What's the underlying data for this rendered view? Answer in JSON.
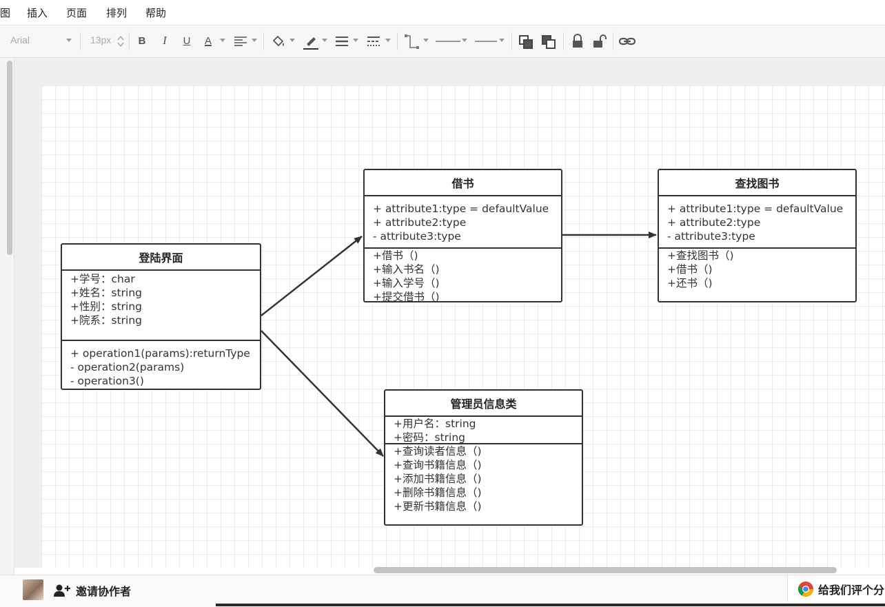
{
  "menu": {
    "items": [
      "图",
      "插入",
      "页面",
      "排列",
      "帮助"
    ]
  },
  "toolbar": {
    "font_family": "Arial",
    "font_size": "13px",
    "bold_label": "B",
    "italic_label": "I",
    "underline_label": "U",
    "font_color_label": "A"
  },
  "diagram": {
    "classes": [
      {
        "title": "登陆界面",
        "attributes": [
          "+学号：char",
          "+姓名：string",
          "+性别：string",
          "+院系：string"
        ],
        "operations": [
          "+ operation1(params):returnType",
          "- operation2(params)",
          "- operation3()"
        ]
      },
      {
        "title": "借书",
        "attributes": [
          "+ attribute1:type = defaultValue",
          "+ attribute2:type",
          "- attribute3:type"
        ],
        "operations": [
          "+借书（)",
          "+输入书名（)",
          "+输入学号（)",
          "+提交借书（)"
        ]
      },
      {
        "title": "查找图书",
        "attributes": [
          "+ attribute1:type = defaultValue",
          "+ attribute2:type",
          "- attribute3:type"
        ],
        "operations": [
          "+查找图书（)",
          "+借书（)",
          "+还书（)"
        ]
      },
      {
        "title": "管理员信息类",
        "attributes": [
          "+用户名：string",
          "+密码：string"
        ],
        "operations": [
          "+查询读者信息（)",
          "+查询书籍信息（)",
          "+添加书籍信息（)",
          "+删除书籍信息（)",
          "+更新书籍信息（)"
        ]
      }
    ]
  },
  "footer": {
    "invite_label": "邀请协作者",
    "rate_label": "给我们评个分"
  },
  "colors": {
    "grid": "#ececec",
    "border": "#333333",
    "canvas_bg": "#efefef"
  }
}
